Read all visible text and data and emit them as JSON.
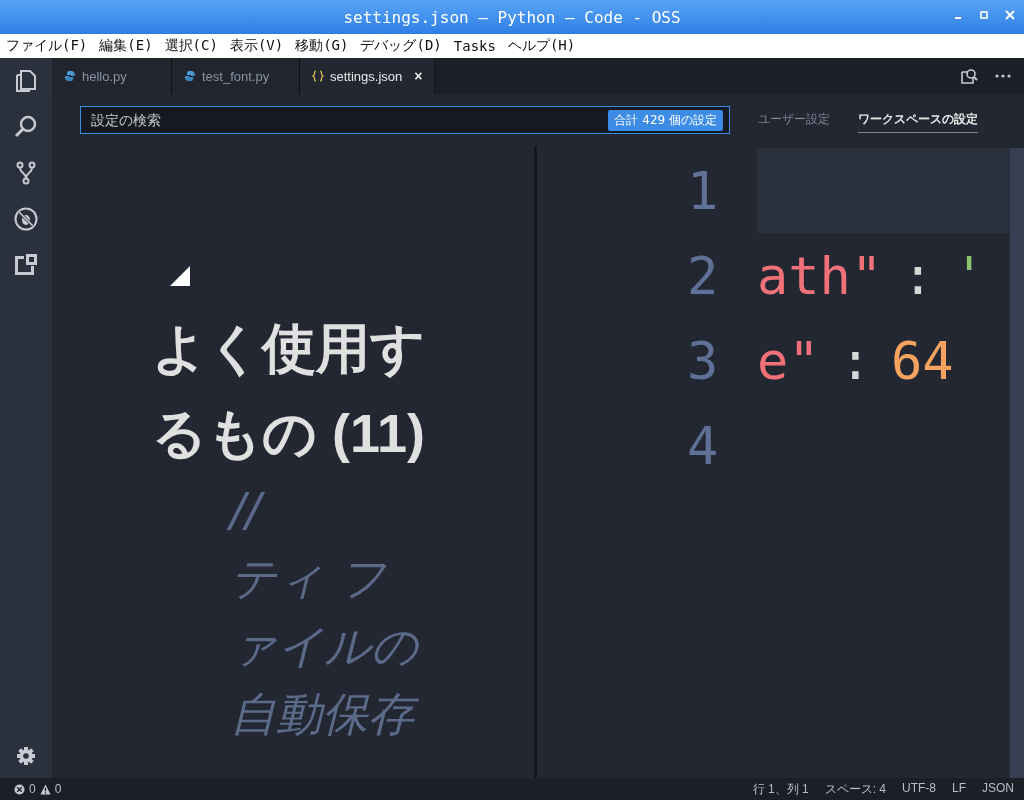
{
  "window": {
    "title": "settings.json — Python — Code - OSS"
  },
  "menu": [
    "ファイル(F)",
    "編集(E)",
    "選択(C)",
    "表示(V)",
    "移動(G)",
    "デバッグ(D)",
    "Tasks",
    "ヘルプ(H)"
  ],
  "tabs": [
    {
      "label": "hello.py",
      "kind": "python",
      "selected": false
    },
    {
      "label": "test_font.py",
      "kind": "python",
      "selected": false
    },
    {
      "label": "settings.json",
      "kind": "json",
      "selected": true,
      "close": "×"
    }
  ],
  "settings_search": {
    "placeholder": "設定の検索",
    "count_badge": "合計 429 個の設定"
  },
  "scope_tabs": [
    {
      "label": "ユーザー設定",
      "selected": false
    },
    {
      "label": "ワークスペースの設定",
      "selected": true
    }
  ],
  "settings_group": {
    "expanded": true,
    "title": "よく使用するもの (11)",
    "comment_lines": [
      "//",
      "ティ フ",
      "ァイルの",
      "自動保存"
    ]
  },
  "editor": {
    "lines": [
      {
        "number": "1",
        "selected": true
      },
      {
        "number": "2",
        "selected": false,
        "tokens": [
          {
            "kind": "key",
            "text": "ath\""
          },
          {
            "kind": "punct",
            "text": ":"
          },
          {
            "kind": "string",
            "text": "'"
          }
        ]
      },
      {
        "number": "3",
        "selected": false,
        "tokens": [
          {
            "kind": "key",
            "text": "e\""
          },
          {
            "kind": "punct",
            "text": ":"
          },
          {
            "kind": "number",
            "text": "64"
          }
        ]
      },
      {
        "number": "4",
        "selected": false
      }
    ]
  },
  "status_bar": {
    "errors": "0",
    "warnings": "0",
    "items": [
      "行 1、列 1",
      "スペース: 4",
      "UTF-8",
      "LF",
      "JSON"
    ]
  }
}
